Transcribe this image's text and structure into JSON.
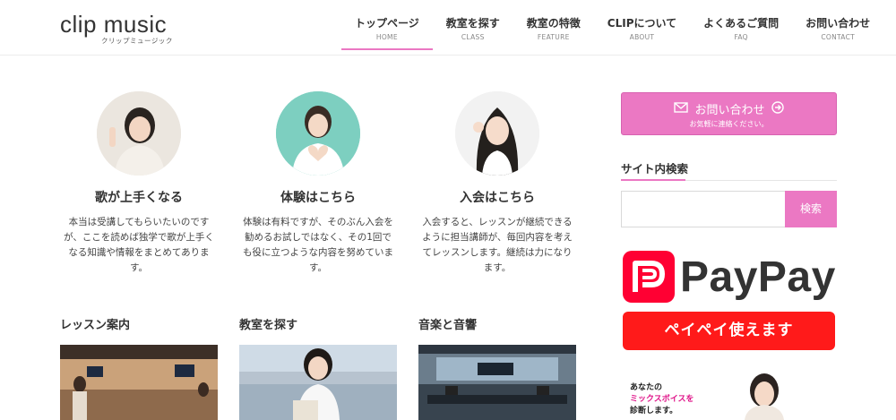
{
  "logo": {
    "main": "clip music",
    "sub": "クリップミュージック"
  },
  "nav": [
    {
      "jp": "トップページ",
      "en": "HOME",
      "active": true
    },
    {
      "jp": "教室を探す",
      "en": "CLASS",
      "active": false
    },
    {
      "jp": "教室の特徴",
      "en": "FEATURE",
      "active": false
    },
    {
      "jp": "CLIPについて",
      "en": "ABOUT",
      "active": false
    },
    {
      "jp": "よくあるご質問",
      "en": "FAQ",
      "active": false
    },
    {
      "jp": "お問い合わせ",
      "en": "CONTACT",
      "active": false
    }
  ],
  "features": [
    {
      "title": "歌が上手くなる",
      "lines": [
        "本当は受講してもらいたいのです",
        "が、ここを読めば独学で歌が上手く",
        "なる知識や情報をまとめてありま",
        "す。"
      ]
    },
    {
      "title": "体験はこちら",
      "lines": [
        "体験は有料ですが、そのぶん入会を",
        "勧めるお試しではなく、その1回で",
        "も役に立つような内容を努めていま",
        "す。"
      ]
    },
    {
      "title": "入会はこちら",
      "lines": [
        "入会すると、レッスンが継続できる",
        "ように担当講師が、毎回内容を考え",
        "てレッスンします。継続は力になり",
        "ます。"
      ]
    }
  ],
  "sections": [
    "レッスン案内",
    "教室を探す",
    "音楽と音響"
  ],
  "sidebar": {
    "contact_label": "お問い合わせ",
    "contact_sub": "お気軽に連絡ください。",
    "search_title": "サイト内検索",
    "search_button": "検索",
    "search_placeholder": "",
    "paypay_word": "PayPay",
    "paypay_banner": "ペイペイ使えます",
    "ad_line1": "あなたの",
    "ad_line2": "ミックスボイスを",
    "ad_line3": "診断します。"
  },
  "colors": {
    "accent": "#eb78c3",
    "paypay_red": "#ff0033"
  }
}
